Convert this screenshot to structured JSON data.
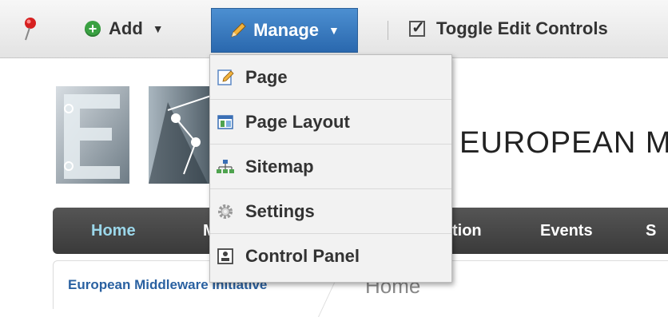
{
  "dockbar": {
    "add_label": "Add",
    "manage_label": "Manage",
    "toggle_label": "Toggle Edit Controls"
  },
  "site": {
    "title": "EUROPEAN M"
  },
  "nav": {
    "items": [
      "Home",
      "M",
      "tion",
      "Events",
      "S"
    ]
  },
  "breadcrumb": {
    "link": "European Middleware Initiative",
    "current": "Home"
  },
  "manage_menu": {
    "items": [
      "Page",
      "Page Layout",
      "Sitemap",
      "Settings",
      "Control Panel"
    ]
  },
  "colors": {
    "manage_bg": "#2a68ae",
    "nav_active": "#9bd7ea",
    "link": "#2a61a1"
  }
}
